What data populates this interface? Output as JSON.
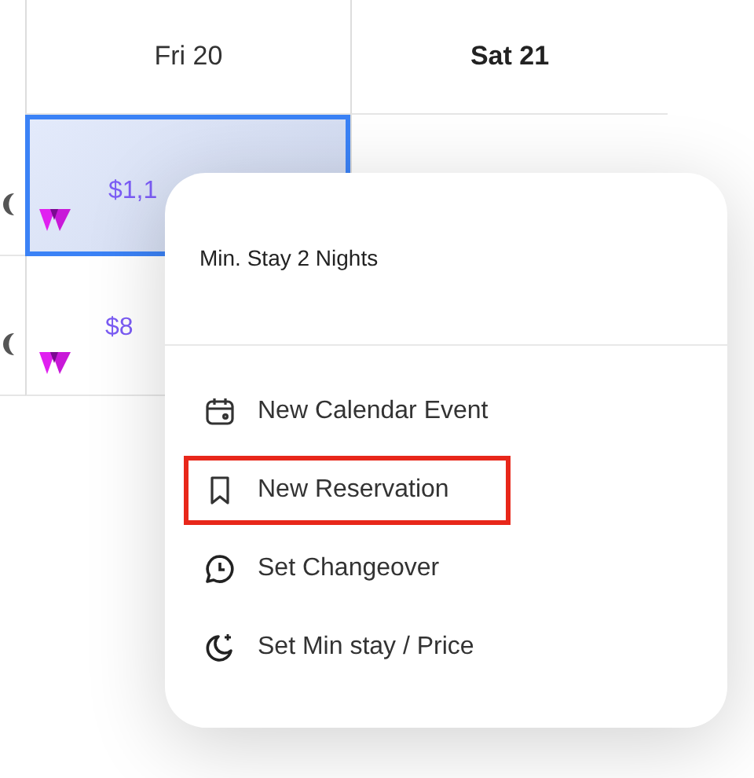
{
  "calendar": {
    "columns": [
      {
        "label": "Fri 20",
        "emphasized": false
      },
      {
        "label": "Sat 21",
        "emphasized": true
      }
    ],
    "rows": [
      {
        "cells": [
          {
            "price": "$1,1",
            "selected": true
          },
          {
            "selected": false
          }
        ]
      },
      {
        "cells": [
          {
            "price": "$8",
            "selected": false
          }
        ]
      }
    ]
  },
  "context_menu": {
    "header": "Min. Stay 2 Nights",
    "items": [
      {
        "kind": "calendar",
        "label": "New Calendar Event",
        "highlighted": false
      },
      {
        "kind": "bookmark",
        "label": "New Reservation",
        "highlighted": true
      },
      {
        "kind": "changeover",
        "label": "Set Changeover",
        "highlighted": false
      },
      {
        "kind": "minstay",
        "label": "Set Min stay / Price",
        "highlighted": false
      }
    ]
  }
}
